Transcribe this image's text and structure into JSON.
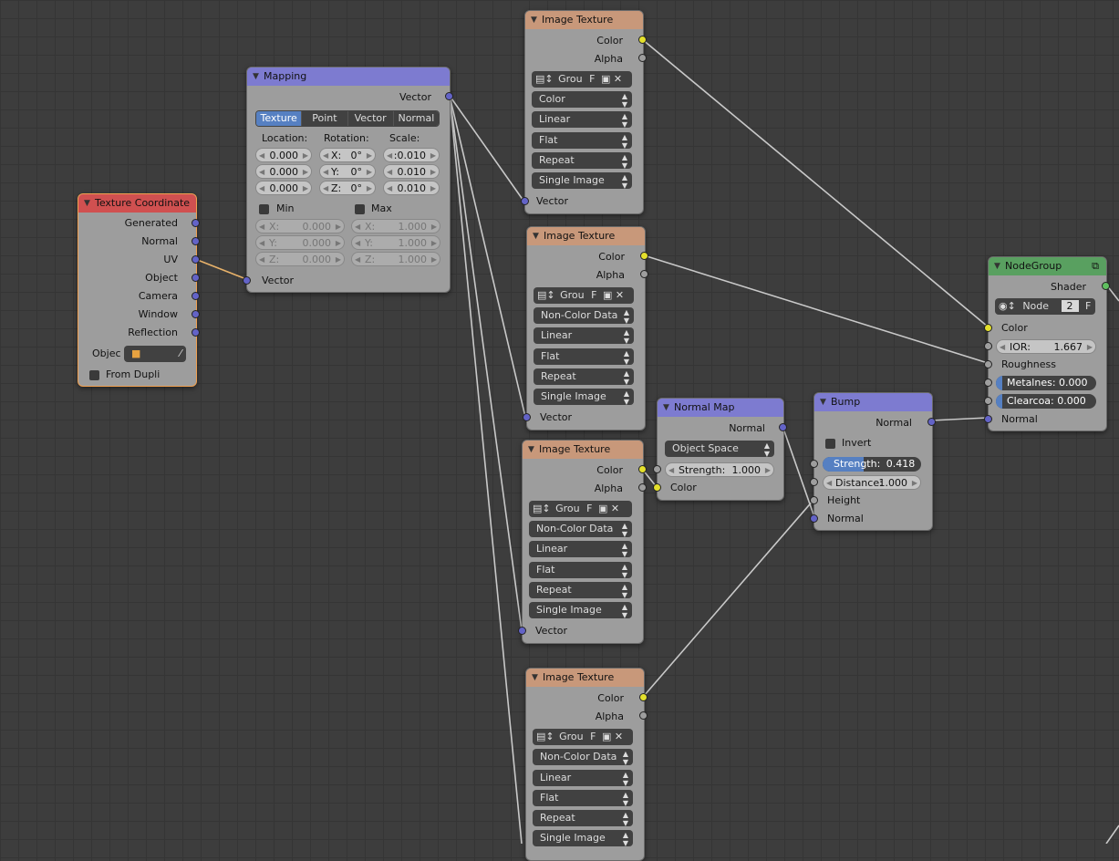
{
  "texture_coordinate": {
    "title": "Texture Coordinate",
    "outputs": [
      "Generated",
      "Normal",
      "UV",
      "Object",
      "Camera",
      "Window",
      "Reflection"
    ],
    "object_label": "Objec",
    "from_dupli_label": "From Dupli"
  },
  "mapping": {
    "title": "Mapping",
    "output_label": "Vector",
    "modes": [
      "Texture",
      "Point",
      "Vector",
      "Normal"
    ],
    "active_mode": "Texture",
    "location_label": "Location:",
    "rotation_label": "Rotation:",
    "scale_label": "Scale:",
    "location": [
      "0.000",
      "0.000",
      "0.000"
    ],
    "rotation": [
      {
        "axis": "X:",
        "value": "0°"
      },
      {
        "axis": "Y:",
        "value": "0°"
      },
      {
        "axis": "Z:",
        "value": "0°"
      }
    ],
    "scale": [
      ":0.010",
      "0.010",
      "0.010"
    ],
    "min_label": "Min",
    "max_label": "Max",
    "min": [
      {
        "axis": "X:",
        "value": "0.000"
      },
      {
        "axis": "Y:",
        "value": "0.000"
      },
      {
        "axis": "Z:",
        "value": "0.000"
      }
    ],
    "max": [
      {
        "axis": "X:",
        "value": "1.000"
      },
      {
        "axis": "Y:",
        "value": "1.000"
      },
      {
        "axis": "Z:",
        "value": "1.000"
      }
    ],
    "input_label": "Vector"
  },
  "image_textures": [
    {
      "title": "Image Texture",
      "color_label": "Color",
      "alpha_label": "Alpha",
      "image_name": "Grou",
      "fake_user": "F",
      "color_space": "Color",
      "interpolation": "Linear",
      "projection": "Flat",
      "extension": "Repeat",
      "source": "Single Image",
      "vector_label": "Vector"
    },
    {
      "title": "Image Texture",
      "color_label": "Color",
      "alpha_label": "Alpha",
      "image_name": "Grou",
      "fake_user": "F",
      "color_space": "Non-Color Data",
      "interpolation": "Linear",
      "projection": "Flat",
      "extension": "Repeat",
      "source": "Single Image",
      "vector_label": "Vector"
    },
    {
      "title": "Image Texture",
      "color_label": "Color",
      "alpha_label": "Alpha",
      "image_name": "Grou",
      "fake_user": "F",
      "color_space": "Non-Color Data",
      "interpolation": "Linear",
      "projection": "Flat",
      "extension": "Repeat",
      "source": "Single Image",
      "vector_label": "Vector"
    },
    {
      "title": "Image Texture",
      "color_label": "Color",
      "alpha_label": "Alpha",
      "image_name": "Grou",
      "fake_user": "F",
      "color_space": "Non-Color Data",
      "interpolation": "Linear",
      "projection": "Flat",
      "extension": "Repeat",
      "source": "Single Image"
    }
  ],
  "normal_map": {
    "title": "Normal Map",
    "output_label": "Normal",
    "space": "Object Space",
    "strength_label": "Strength:",
    "strength": "1.000",
    "color_label": "Color"
  },
  "bump": {
    "title": "Bump",
    "output_label": "Normal",
    "invert_label": "Invert",
    "strength_label": "Strength:",
    "strength": "0.418",
    "strength_fraction": 0.418,
    "distance_label": "Distance:",
    "distance": "1.000",
    "height_label": "Height",
    "normal_label": "Normal"
  },
  "node_group": {
    "title": "NodeGroup",
    "output_label": "Shader",
    "group_name": "Node",
    "users": "2",
    "fake_user": "F",
    "color_label": "Color",
    "ior_label": "IOR:",
    "ior": "1.667",
    "roughness_label": "Roughness",
    "metalness_label": "Metalnes:",
    "metalness": "0.000",
    "clearcoat_label": "Clearcoa:",
    "clearcoat": "0.000",
    "normal_label": "Normal"
  },
  "colors": {
    "socket_color": "#e4e02c",
    "socket_float": "#9e9e9e",
    "socket_vector": "#6363c7",
    "socket_shader": "#60c060",
    "texture_header": "#c8987a",
    "vector_header": "#7d7bd0",
    "input_header": "#d05050",
    "group_header": "#59a060",
    "selection": "#f0a050"
  }
}
